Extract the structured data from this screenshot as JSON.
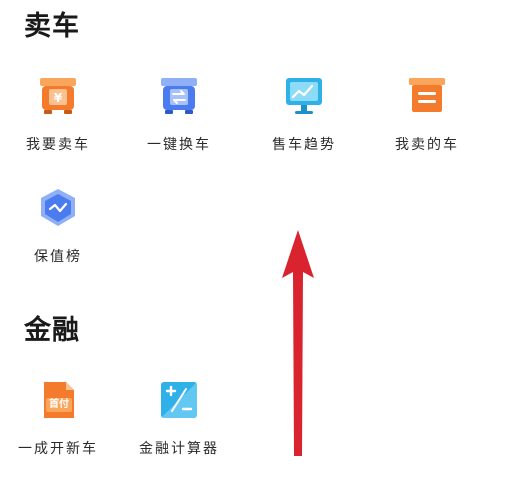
{
  "sell_section": {
    "title": "卖车",
    "items": [
      {
        "label": "我要卖车",
        "icon": "sell-car-icon"
      },
      {
        "label": "一键换车",
        "icon": "exchange-car-icon"
      },
      {
        "label": "售车趋势",
        "icon": "sales-trend-icon"
      },
      {
        "label": "我卖的车",
        "icon": "my-sold-cars-icon"
      },
      {
        "label": "保值榜",
        "icon": "value-ranking-icon"
      }
    ]
  },
  "finance_section": {
    "title": "金融",
    "items": [
      {
        "label": "一成开新车",
        "icon": "down-payment-icon",
        "badge": "首付"
      },
      {
        "label": "金融计算器",
        "icon": "calculator-icon"
      }
    ]
  },
  "colors": {
    "orange": "#F47A2C",
    "blue": "#4A7BEF",
    "teal": "#2FB0E8",
    "arrow_red": "#D9232E"
  }
}
